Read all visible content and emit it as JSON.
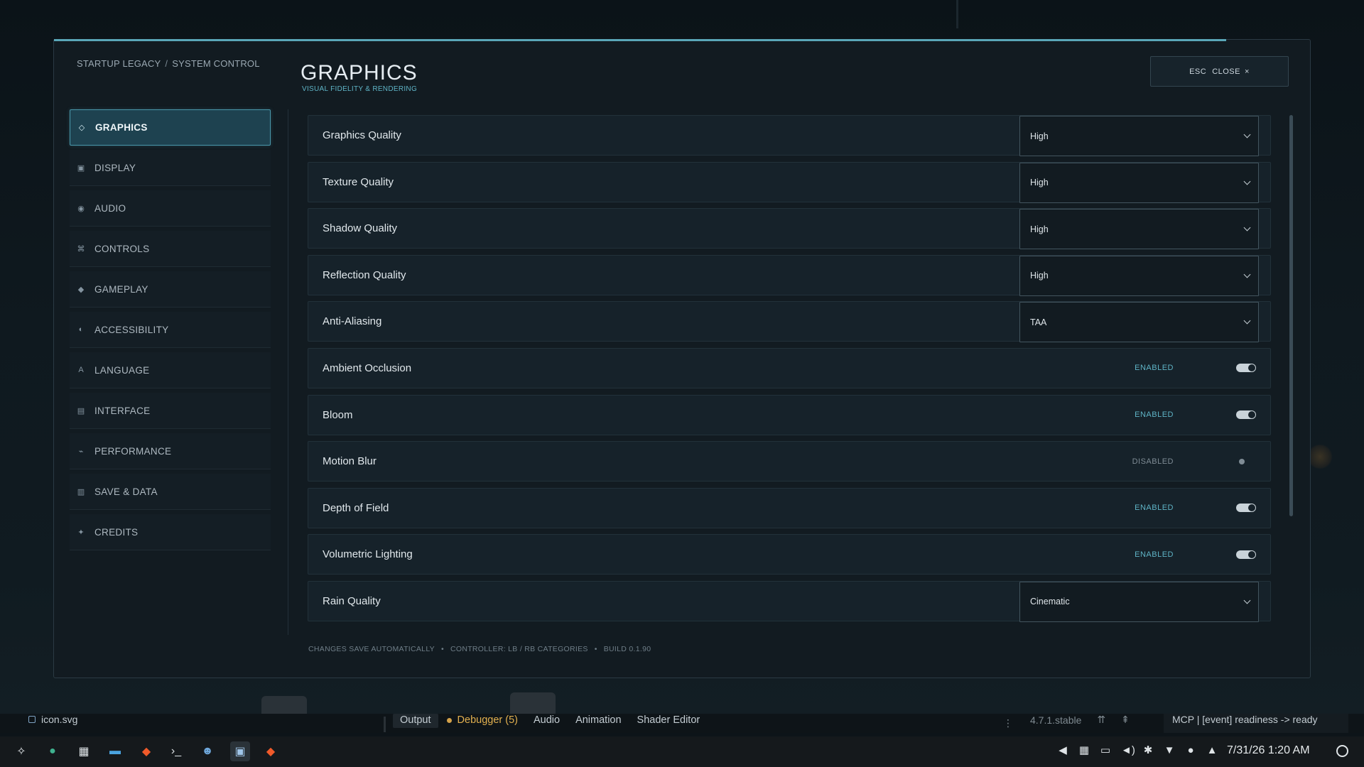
{
  "breadcrumb": {
    "root": "STARTUP LEGACY",
    "separator": "/",
    "current": "SYSTEM CONTROL"
  },
  "header": {
    "title": "GRAPHICS",
    "subtitle": "VISUAL FIDELITY & RENDERING"
  },
  "close_button": {
    "key": "ESC",
    "label": "CLOSE",
    "glyph": "×"
  },
  "sidebar": {
    "items": [
      {
        "icon": "◇",
        "icon_name": "diamond-outline-icon",
        "label": "GRAPHICS",
        "active": true
      },
      {
        "icon": "▣",
        "icon_name": "display-icon",
        "label": "DISPLAY"
      },
      {
        "icon": "◉",
        "icon_name": "audio-icon",
        "label": "AUDIO"
      },
      {
        "icon": "⌘",
        "icon_name": "controls-icon",
        "label": "CONTROLS"
      },
      {
        "icon": "◆",
        "icon_name": "gameplay-icon",
        "label": "GAMEPLAY"
      },
      {
        "icon": "◐",
        "icon_name": "accessibility-icon",
        "label": "ACCESSIBILITY"
      },
      {
        "icon": "A",
        "icon_name": "language-icon",
        "label": "LANGUAGE"
      },
      {
        "icon": "▤",
        "icon_name": "interface-icon",
        "label": "INTERFACE"
      },
      {
        "icon": "⌁",
        "icon_name": "performance-icon",
        "label": "PERFORMANCE"
      },
      {
        "icon": "▥",
        "icon_name": "save-icon",
        "label": "SAVE & DATA"
      },
      {
        "icon": "✦",
        "icon_name": "credits-icon",
        "label": "CREDITS"
      }
    ]
  },
  "settings": [
    {
      "label": "Graphics Quality",
      "type": "dropdown",
      "value": "High"
    },
    {
      "label": "Texture Quality",
      "type": "dropdown",
      "value": "High"
    },
    {
      "label": "Shadow Quality",
      "type": "dropdown",
      "value": "High"
    },
    {
      "label": "Reflection Quality",
      "type": "dropdown",
      "value": "High"
    },
    {
      "label": "Anti-Aliasing",
      "type": "dropdown",
      "value": "TAA"
    },
    {
      "label": "Ambient Occlusion",
      "type": "toggle",
      "status": "ENABLED",
      "on": true
    },
    {
      "label": "Bloom",
      "type": "toggle",
      "status": "ENABLED",
      "on": true
    },
    {
      "label": "Motion Blur",
      "type": "toggle",
      "status": "DISABLED",
      "on": false
    },
    {
      "label": "Depth of Field",
      "type": "toggle",
      "status": "ENABLED",
      "on": true
    },
    {
      "label": "Volumetric Lighting",
      "type": "toggle",
      "status": "ENABLED",
      "on": true
    },
    {
      "label": "Rain Quality",
      "type": "dropdown",
      "value": "Cinematic"
    }
  ],
  "footer": {
    "parts": [
      "CHANGES SAVE AUTOMATICALLY",
      "CONTROLLER: LB / RB CATEGORIES",
      "BUILD 0.1.90"
    ],
    "separator": "•"
  },
  "editor": {
    "file": "icon.svg",
    "tabs": [
      "Output",
      "Debugger (5)",
      "Audio",
      "Animation",
      "Shader Editor"
    ],
    "kebab": "⋮",
    "version": "4.7.1.stable",
    "version_icons": [
      "⇈",
      "⇞"
    ],
    "mcp_status": "MCP | [event] readiness -> ready"
  },
  "taskbar": {
    "apps": [
      {
        "name": "launcher-icon",
        "glyph": "✧",
        "color": "#dfe4e7"
      },
      {
        "name": "app-icon",
        "glyph": "●",
        "color": "#3fb28f"
      },
      {
        "name": "grid-apps-icon",
        "glyph": "▦",
        "color": "#dfe4e7"
      },
      {
        "name": "file-manager-icon",
        "glyph": "▬",
        "color": "#4aa3df"
      },
      {
        "name": "brave-browser-icon",
        "glyph": "◆",
        "color": "#f05a2a"
      },
      {
        "name": "terminal-icon",
        "glyph": "›_",
        "color": "#dfe4e7"
      },
      {
        "name": "godot-icon",
        "glyph": "☻",
        "color": "#6fa8dc"
      },
      {
        "name": "monitor-app-icon",
        "glyph": "▣",
        "color": "#9fc5e8"
      },
      {
        "name": "brave-browser-2-icon",
        "glyph": "◆",
        "color": "#f05a2a"
      }
    ],
    "tray": [
      {
        "name": "notification-icon",
        "glyph": "◀"
      },
      {
        "name": "spreadsheet-icon",
        "glyph": "▦"
      },
      {
        "name": "clipboard-icon",
        "glyph": "▭"
      },
      {
        "name": "volume-icon",
        "glyph": "◄)"
      },
      {
        "name": "settings-icon",
        "glyph": "✱"
      },
      {
        "name": "wifi-icon",
        "glyph": "▼"
      },
      {
        "name": "update-icon",
        "glyph": "●"
      },
      {
        "name": "tray-expand-icon",
        "glyph": "▲"
      }
    ],
    "clock": "7/31/26  1:20 AM"
  },
  "colors": {
    "accent": "#5fb4c6",
    "active_bg": "#1e4250",
    "panel_bg": "#121b21"
  }
}
